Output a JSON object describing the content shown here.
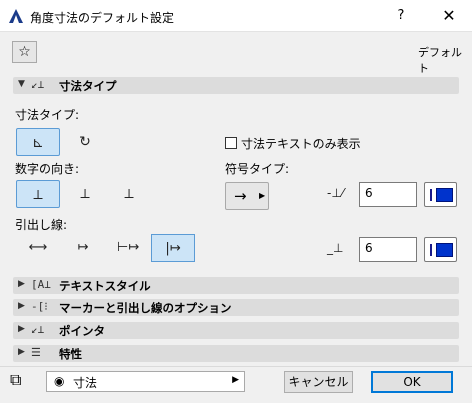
{
  "window": {
    "title": "角度寸法のデフォルト設定",
    "help": "?",
    "close": "✕"
  },
  "favorite": {
    "icon": "star-icon",
    "glyph": "☆",
    "default_label": "デフォルト"
  },
  "sections": {
    "dimension_type": {
      "label": "寸法タイプ",
      "expanded": true,
      "arrow": "▼",
      "icon": "↙⊥"
    },
    "text_style": {
      "label": "テキストスタイル",
      "expanded": false,
      "arrow": "▶",
      "icon": "[A⊥"
    },
    "marker_options": {
      "label": "マーカーと引出し線のオプション",
      "expanded": false,
      "arrow": "▶",
      "icon": "-[⁝"
    },
    "pointer": {
      "label": "ポインタ",
      "expanded": false,
      "arrow": "▶",
      "icon": "↙⊥"
    },
    "properties": {
      "label": "特性",
      "expanded": false,
      "arrow": "▶",
      "icon": "☰"
    }
  },
  "dimension": {
    "type_label": "寸法タイプ:",
    "type_options": [
      {
        "name": "angle-dimension",
        "glyph": "⊾",
        "selected": true
      },
      {
        "name": "arc-dimension",
        "glyph": "↻",
        "selected": false
      }
    ],
    "text_only_label": "寸法テキストのみ表示",
    "text_only_checked": false,
    "orientation_label": "数字の向き:",
    "orientation_options": [
      {
        "name": "horizontal-text",
        "glyph": "⟂",
        "selected": true
      },
      {
        "name": "aligned-text",
        "glyph": "⟂",
        "selected": false
      },
      {
        "name": "rotated-text",
        "glyph": "⟂",
        "selected": false
      }
    ],
    "symbol_type_label": "符号タイプ:",
    "symbol_type_glyph": "→",
    "symbol_type_caret": "▶",
    "symbol_size_value": "6",
    "symbol_size_icon": "-⊥⁄",
    "leader_label": "引出し線:",
    "leader_options": [
      {
        "name": "leader-arrows",
        "glyph": "⟷",
        "selected": false
      },
      {
        "name": "leader-ticks",
        "glyph": "↦",
        "selected": false
      },
      {
        "name": "leader-ext",
        "glyph": "⊢↦",
        "selected": false
      },
      {
        "name": "leader-ext-diag",
        "glyph": "|↦",
        "selected": true
      }
    ],
    "pen_value": "6",
    "pen_icon": "_⊥",
    "pen_color": "#0033cc"
  },
  "footer": {
    "layer_icon": "layers-icon",
    "layer_glyph": "⧉",
    "layer_value": "寸法",
    "layer_eye": "◉",
    "layer_caret": "▶",
    "cancel": "キャンセル",
    "ok": "OK"
  }
}
